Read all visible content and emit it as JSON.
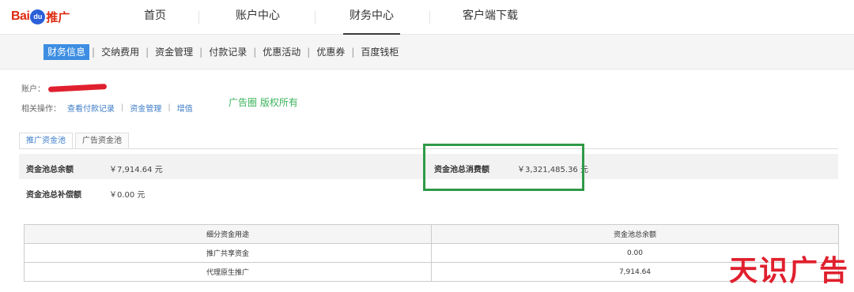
{
  "logo": {
    "text_bai": "Bai",
    "text_du": "du",
    "text_tuiguang": "推广"
  },
  "topnav": {
    "items": [
      {
        "label": "首页"
      },
      {
        "label": "账户中心"
      },
      {
        "label": "财务中心",
        "active": true
      },
      {
        "label": "客户端下载"
      }
    ]
  },
  "subnav": {
    "items": [
      {
        "label": "财务信息",
        "active": true
      },
      {
        "label": "交纳费用"
      },
      {
        "label": "资金管理"
      },
      {
        "label": "付款记录"
      },
      {
        "label": "优惠活动"
      },
      {
        "label": "优惠券"
      },
      {
        "label": "百度钱柜"
      }
    ],
    "separator": "|"
  },
  "account": {
    "label": "账户："
  },
  "related_ops": {
    "label": "相关操作：",
    "links": [
      "查看付款记录",
      "资金管理",
      "增值"
    ],
    "separator": "|"
  },
  "watermark_text": "广告圈 版权所有",
  "tabs": [
    {
      "label": "推广资金池",
      "active": true
    },
    {
      "label": "广告资金池"
    }
  ],
  "summary": {
    "total_balance_label": "资金池总余额",
    "total_balance_value": "￥7,914.64 元",
    "total_spend_label": "资金池总消费额",
    "total_spend_value": "￥3,321,485.36 元",
    "total_compensation_label": "资金池总补偿额",
    "total_compensation_value": "￥0.00 元"
  },
  "detail_table": {
    "headers": [
      "细分资金用途",
      "资金池总余额"
    ],
    "rows": [
      [
        "推广共享资金",
        "0.00"
      ],
      [
        "代理原生推广",
        "7,914.64"
      ]
    ]
  },
  "brand_watermark": "天识广告",
  "colors": {
    "accent_blue": "#3d8ee2",
    "highlight_green": "#2f9a47",
    "brand_red": "#e0202e"
  }
}
